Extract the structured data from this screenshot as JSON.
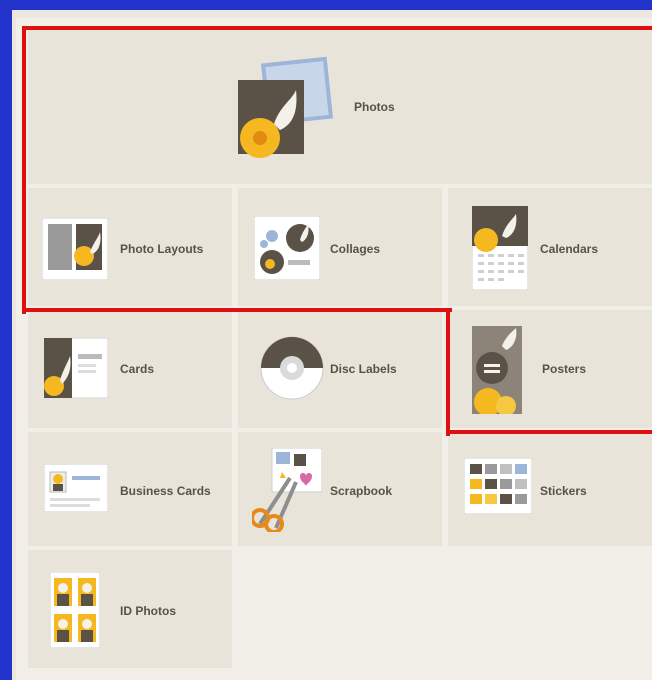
{
  "tiles": {
    "photos": "Photos",
    "photo_layouts": "Photo Layouts",
    "collages": "Collages",
    "calendars": "Calendars",
    "cards": "Cards",
    "disc_labels": "Disc Labels",
    "posters": "Posters",
    "business_cards": "Business Cards",
    "scrapbook": "Scrapbook",
    "stickers": "Stickers",
    "id_photos": "ID Photos"
  },
  "colors": {
    "frame_border": "#2233cc",
    "highlight": "#e01010",
    "tile_bg": "#e9e4da",
    "accent_yellow": "#f5b820",
    "photo_dark": "#5b5247"
  }
}
